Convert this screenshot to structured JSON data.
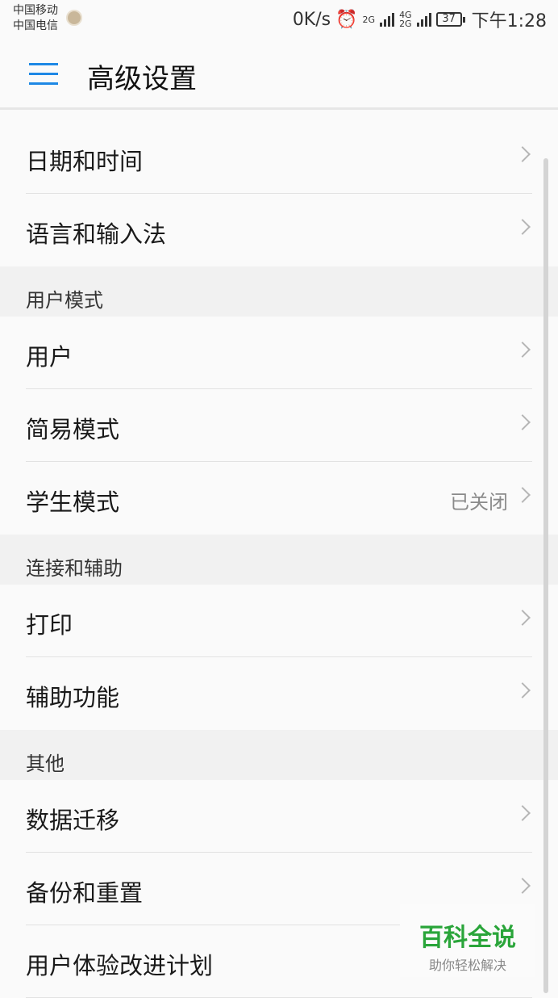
{
  "status_bar": {
    "carrier_1": "中国移动",
    "carrier_2": "中国电信",
    "speed": "0K/s",
    "net_1": "2G",
    "net_2_top": "4G",
    "net_2_bottom": "2G",
    "battery": "37",
    "time": "下午1:28"
  },
  "app_bar": {
    "title": "高级设置",
    "menu_icon": "menu-icon",
    "accent_color": "#1e88e5"
  },
  "groups": [
    {
      "header": "",
      "rows": [
        {
          "label": "日期和时间",
          "value": ""
        },
        {
          "label": "语言和输入法",
          "value": ""
        }
      ]
    },
    {
      "header": "用户模式",
      "rows": [
        {
          "label": "用户",
          "value": ""
        },
        {
          "label": "简易模式",
          "value": ""
        },
        {
          "label": "学生模式",
          "value": "已关闭"
        }
      ]
    },
    {
      "header": "连接和辅助",
      "rows": [
        {
          "label": "打印",
          "value": ""
        },
        {
          "label": "辅助功能",
          "value": ""
        }
      ]
    },
    {
      "header": "其他",
      "rows": [
        {
          "label": "数据迁移",
          "value": ""
        },
        {
          "label": "备份和重置",
          "value": ""
        },
        {
          "label": "用户体验改进计划",
          "value": ""
        }
      ]
    }
  ],
  "watermark": {
    "logo": "百科全说",
    "slogan": "助你轻松解决",
    "color": "#2aa53a"
  }
}
